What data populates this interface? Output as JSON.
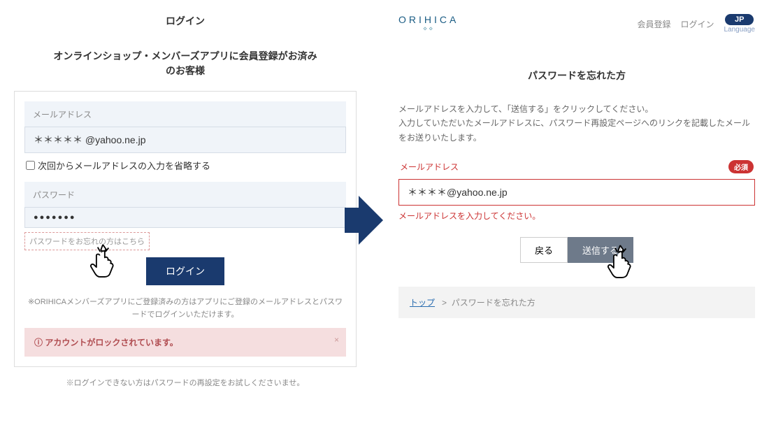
{
  "left": {
    "title": "ログイン",
    "subtitle": "オンラインショップ・メンバーズアプリに会員登録がお済み\nのお客様",
    "email_label": "メールアドレス",
    "email_value": "＊＊＊＊＊ @yahoo.ne.jp",
    "remember_label": "次回からメールアドレスの入力を省略する",
    "password_label": "パスワード",
    "password_value": "●●●●●●●",
    "forgot_link": "パスワードをお忘れの方はこちら",
    "login_button": "ログイン",
    "note": "※ORIHICAメンバーズアプリにご登録済みの方はアプリにご登録のメールアドレスとパスワードでログインいただけます。",
    "alert": "アカウントがロックされています。",
    "footer": "※ログインできない方はパスワードの再設定をお試しくださいませ。"
  },
  "right": {
    "brand": "ORIHICA",
    "nav_register": "会員登録",
    "nav_login": "ログイン",
    "lang_chip": "JP",
    "lang_label": "Language",
    "title": "パスワードを忘れた方",
    "desc": "メールアドレスを入力して、「送信する」をクリックしてください。\n入力していただいたメールアドレスに、パスワード再設定ページへのリンクを記載したメールをお送りいたします。",
    "email_label": "メールアドレス",
    "required_badge": "必須",
    "email_value": "＊＊＊＊@yahoo.ne.jp",
    "error_msg": "メールアドレスを入力してください。",
    "back_button": "戻る",
    "send_button": "送信する",
    "crumb_top": "トップ",
    "crumb_sep": ">",
    "crumb_here": "パスワードを忘れた方"
  }
}
